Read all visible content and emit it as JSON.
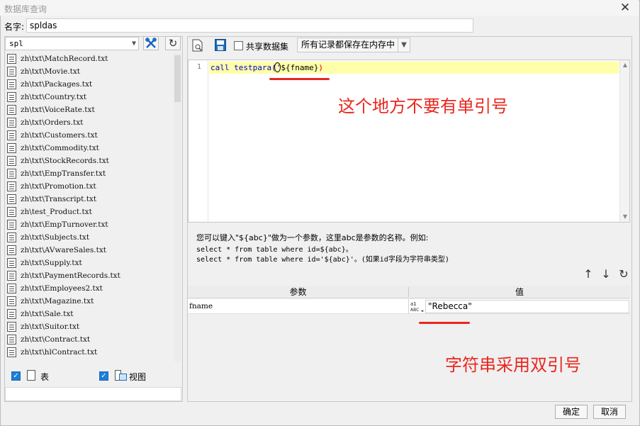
{
  "window": {
    "title": "数据库查询"
  },
  "name_row": {
    "label": "名字:",
    "value": "spldas"
  },
  "left": {
    "source_combo": "spl",
    "files": [
      "zh\\txt\\MatchRecord.txt",
      "zh\\txt\\Movie.txt",
      "zh\\txt\\Packages.txt",
      "zh\\txt\\Country.txt",
      "zh\\txt\\VoiceRate.txt",
      "zh\\txt\\Orders.txt",
      "zh\\txt\\Customers.txt",
      "zh\\txt\\Commodity.txt",
      "zh\\txt\\StockRecords.txt",
      "zh\\txt\\EmpTransfer.txt",
      "zh\\txt\\Promotion.txt",
      "zh\\txt\\Transcript.txt",
      "zh\\test_Product.txt",
      "zh\\txt\\EmpTurnover.txt",
      "zh\\txt\\Subjects.txt",
      "zh\\txt\\AVwareSales.txt",
      "zh\\txt\\Supply.txt",
      "zh\\txt\\PaymentRecords.txt",
      "zh\\txt\\Employees2.txt",
      "zh\\txt\\Magazine.txt",
      "zh\\txt\\Sale.txt",
      "zh\\txt\\Suitor.txt",
      "zh\\txt\\Contract.txt",
      "zh\\txt\\hlContract.txt"
    ],
    "table_label": "表",
    "view_label": "视图"
  },
  "toolbar": {
    "share_label": "共享数据集",
    "mode_value": "所有记录都保存在内存中"
  },
  "editor": {
    "line_number": "1",
    "code_plain": "call testpara(",
    "code_quote": "'",
    "code_param": "${fname}",
    "code_close": ")"
  },
  "hint": {
    "line1": "您可以键入\"${abc}\"做为一个参数，这里abc是参数的名称。例如:",
    "line2": "select * from table where id=${abc}。",
    "line3": "select * from table where id='${abc}'。(如果id字段为字符串类型)"
  },
  "params": {
    "col_param": "参数",
    "col_value": "值",
    "rows": [
      {
        "name": "fname",
        "type_icon": "ABC",
        "value": "\"Rebecca\""
      }
    ]
  },
  "buttons": {
    "ok": "确定",
    "cancel": "取消"
  },
  "annotations": {
    "no_quote": "这个地方不要有单引号",
    "use_double_quote": "字符串采用双引号",
    "color": "#e8271f"
  }
}
